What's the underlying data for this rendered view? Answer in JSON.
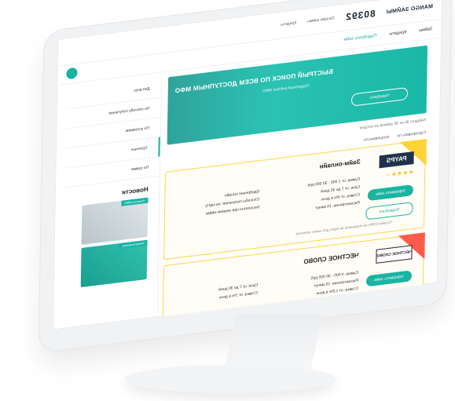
{
  "header": {
    "logo": "MANGO ЗАЙМЫ",
    "phone": "80392",
    "links": [
      "Онлайн займы",
      "Кредиты"
    ]
  },
  "nav": {
    "items": [
      "Займы",
      "Кредиты",
      "Подобрать займ"
    ]
  },
  "hero": {
    "title": "БЫСТРЫЙ ПОИСК ПО ВСЕМ ДОСТУПНЫМ МФО",
    "subtitle": "Подробный рейтинг МФО",
    "button": "Подобрать"
  },
  "breadcrumb": "Найдено 35 из 35 займов за сегодня",
  "filter": [
    "Сортировать по",
    "популярности"
  ],
  "cards": [
    {
      "brand": "PAYPS",
      "name": "Займ-онлайн",
      "stars": "★★★★☆",
      "get": "Оформить займ",
      "more": "Подробнее",
      "col1": [
        "Сумма: от 1 000 - 30 000 руб.",
        "Срок: от 7 до 30 дней",
        "Ставка: от 0% в день",
        "Рассмотрение: 15 минут"
      ],
      "col2": [
        "Одобрение онлайн",
        "Способы получения: на карту",
        "Бесплатно при первом займе"
      ],
      "note": "*Ставка 0,00% на погашение по карте для новых клиентов"
    },
    {
      "brand": "ЧЕСТНОЕ СЛОВО",
      "name": "ЧЕСТНОЕ СЛОВО",
      "stars": "",
      "get": "Оформить займ",
      "more": "",
      "col1": [
        "Сумма: 4 000 - 30 000 руб.",
        "Рассмотрение: 15 минут",
        "Ставка: от 1,5% в день"
      ],
      "col2": [
        "Срок: от 7 до 30 дней",
        "Ставка: от 1% в день"
      ],
      "note": ""
    }
  ],
  "sidebar": {
    "items": [
      "Для всех",
      "По способу получения",
      "По условиям",
      "Срочные",
      "По сумме"
    ],
    "news_title": "Новости",
    "news": [
      "Новости МФО",
      "Новости рынка"
    ]
  }
}
